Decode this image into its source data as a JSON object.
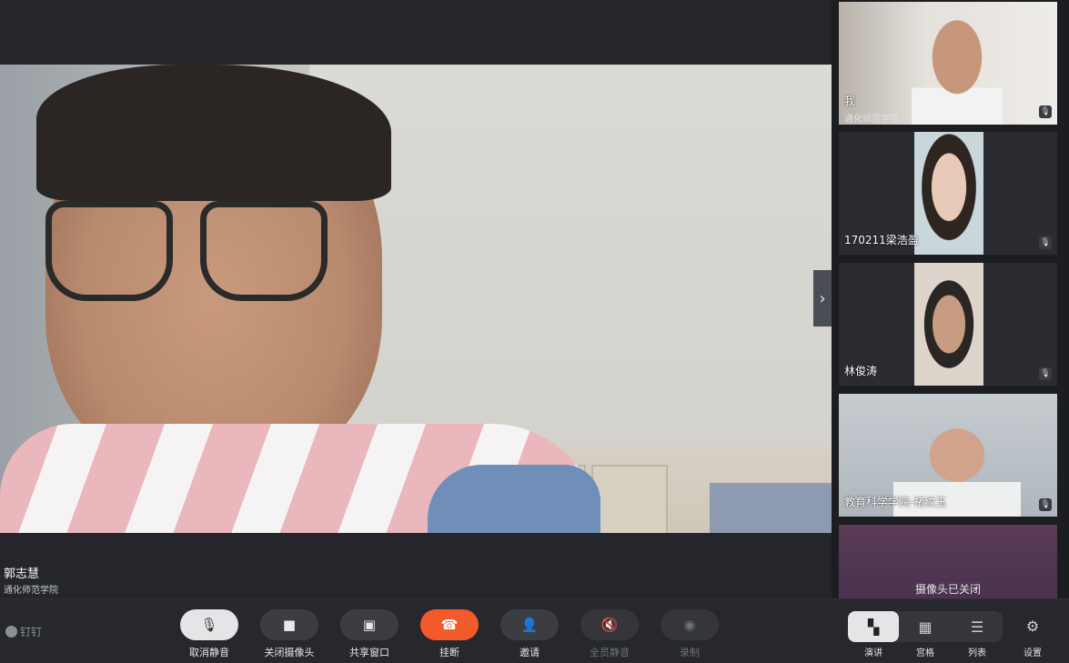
{
  "main": {
    "speaker_name": "郭志慧",
    "speaker_org": "通化师范学院",
    "next_arrow": "›"
  },
  "side_panel": {
    "tiles": [
      {
        "name": "我",
        "org": "通化师范学院",
        "mic": "🎙"
      },
      {
        "name": "170211梁浩盈",
        "mic": "🎙"
      },
      {
        "name": "林俊涛",
        "mic": "🎙"
      },
      {
        "name": "教育科学学院-褚纹玉",
        "mic": "🎙"
      },
      {
        "camera_off_text": "摄像头已关闭"
      }
    ]
  },
  "toolbar": {
    "brand": "钉钉",
    "buttons": [
      {
        "label": "取消静音",
        "icon": "🎙",
        "state": "active"
      },
      {
        "label": "关闭摄像头",
        "icon": "■",
        "state": "normal"
      },
      {
        "label": "共享窗口",
        "icon": "▣",
        "state": "normal"
      },
      {
        "label": "挂断",
        "icon": "☎",
        "state": "hang"
      },
      {
        "label": "邀请",
        "icon": "👤",
        "state": "normal"
      },
      {
        "label": "全员静音",
        "icon": "🔇",
        "state": "disabled"
      },
      {
        "label": "录制",
        "icon": "◉",
        "state": "disabled"
      }
    ],
    "layouts": [
      {
        "label": "演讲",
        "icon": "▚"
      },
      {
        "label": "宫格",
        "icon": "▦"
      },
      {
        "label": "列表",
        "icon": "☰"
      }
    ],
    "settings_label": "设置",
    "settings_icon": "⚙"
  },
  "colors": {
    "hangup": "#f25a2c",
    "toolbar_bg": "#26282d",
    "active_button": "#e4e5e7"
  }
}
